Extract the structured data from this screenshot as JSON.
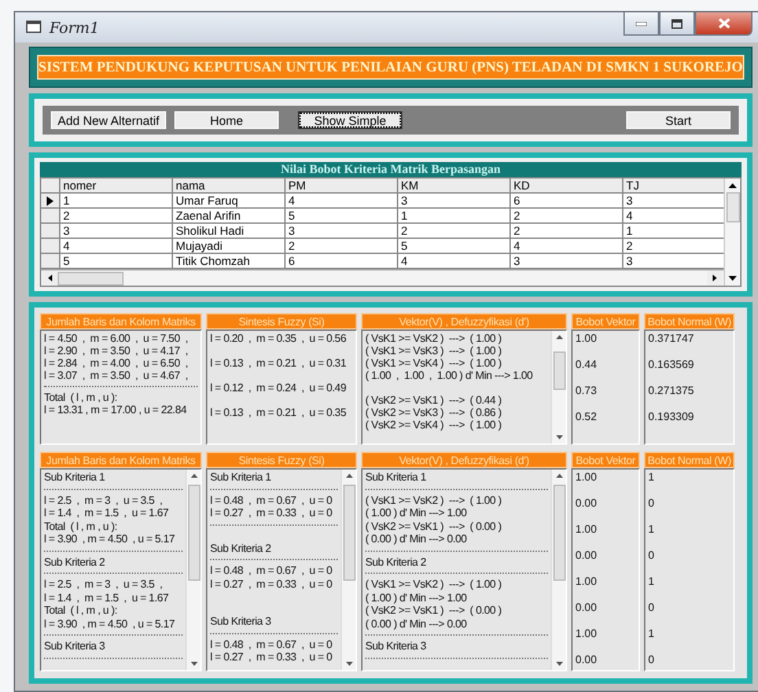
{
  "window": {
    "title": "Form1"
  },
  "banner": {
    "title": "SISTEM PENDUKUNG KEPUTUSAN UNTUK PENILAIAN GURU (PNS) TELADAN DI SMKN 1 SUKOREJO"
  },
  "toolbar": {
    "buttons": [
      {
        "label": "Add New Alternatif",
        "focused": false
      },
      {
        "label": "Home",
        "focused": false
      },
      {
        "label": "Show Simple",
        "focused": true
      },
      {
        "label": "Start",
        "focused": false
      }
    ]
  },
  "grid": {
    "title": "Nilai Bobot Kriteria Matrik Berpasangan",
    "columns": [
      "nomer",
      "nama",
      "PM",
      "KM",
      "KD",
      "TJ"
    ],
    "rows": [
      {
        "selected": true,
        "cells": [
          "1",
          "Umar Faruq",
          "4",
          "3",
          "6",
          "3"
        ]
      },
      {
        "selected": false,
        "cells": [
          "2",
          "Zaenal Arifin",
          "5",
          "1",
          "2",
          "4"
        ]
      },
      {
        "selected": false,
        "cells": [
          "3",
          "Sholikul Hadi",
          "3",
          "2",
          "2",
          "1"
        ]
      },
      {
        "selected": false,
        "cells": [
          "4",
          "Mujayadi",
          "2",
          "5",
          "4",
          "2"
        ]
      },
      {
        "selected": false,
        "cells": [
          "5",
          "Titik Chomzah",
          "6",
          "4",
          "3",
          "3"
        ]
      }
    ]
  },
  "tables": [
    {
      "columns": [
        {
          "header": "Jumlah Baris dan Kolom Matriks",
          "kind": "lines",
          "scrollbar": false,
          "lines": [
            {
              "kind": "text",
              "text": "l = 4.50  ,  m = 6.00  ,  u = 7.50  ,"
            },
            {
              "kind": "text",
              "text": "l = 2.90  ,  m = 3.50  ,  u = 4.17  ,"
            },
            {
              "kind": "text",
              "text": "l = 2.84  ,  m = 4.00  ,  u = 6.50  ,"
            },
            {
              "kind": "text",
              "text": "l = 3.07  ,  m = 3.50  ,  u = 4.67  ,"
            },
            {
              "kind": "rule"
            },
            {
              "kind": "text",
              "text": "Total  ( l , m , u ):"
            },
            {
              "kind": "text",
              "text": "l = 13.31 , m = 17.00 , u = 22.84"
            }
          ]
        },
        {
          "header": "Sintesis Fuzzy (Si)",
          "kind": "lines",
          "scrollbar": false,
          "lines": [
            {
              "kind": "text",
              "text": "l = 0.20  ,  m = 0.35  ,  u = 0.56"
            },
            {
              "kind": "gap"
            },
            {
              "kind": "text",
              "text": "l = 0.13  ,  m = 0.21  ,  u = 0.31"
            },
            {
              "kind": "gap"
            },
            {
              "kind": "text",
              "text": "l = 0.12  ,  m = 0.24  ,  u = 0.49"
            },
            {
              "kind": "gap"
            },
            {
              "kind": "text",
              "text": "l = 0.13  ,  m = 0.21  ,  u = 0.35"
            }
          ]
        },
        {
          "header": "Vektor(V) , Defuzzyfikasi (d')",
          "kind": "lines",
          "scrollbar": true,
          "lines": [
            {
              "kind": "text",
              "text": "( VsK1 >= VsK2 )  --->  ( 1.00 )"
            },
            {
              "kind": "text",
              "text": "( VsK1 >= VsK3 )  --->  ( 1.00 )"
            },
            {
              "kind": "text",
              "text": "( VsK1 >= VsK4 )  --->  ( 1.00 )"
            },
            {
              "kind": "text",
              "text": "( 1.00  ,  1.00  ,  1.00 ) d' Min ---> 1.00"
            },
            {
              "kind": "gap"
            },
            {
              "kind": "text",
              "text": "( VsK2 >= VsK1 )  --->  ( 0.44 )"
            },
            {
              "kind": "text",
              "text": "( VsK2 >= VsK3 )  --->  ( 0.86 )"
            },
            {
              "kind": "text",
              "text": "( VsK2 >= VsK4 )  --->  ( 1.00 )"
            }
          ]
        },
        {
          "header": "Bobot Vektor",
          "kind": "values",
          "scrollbar": false,
          "values": [
            "1.00",
            "0.44",
            "0.73",
            "0.52"
          ]
        },
        {
          "header": "Bobot Normal (W)",
          "kind": "values",
          "scrollbar": false,
          "values": [
            "0.371747",
            "0.163569",
            "0.271375",
            "0.193309"
          ]
        }
      ]
    },
    {
      "columns": [
        {
          "header": "Jumlah Baris dan Kolom Matriks",
          "kind": "lines",
          "scrollbar": true,
          "lines": [
            {
              "kind": "text",
              "text": "Sub Kriteria 1"
            },
            {
              "kind": "rule"
            },
            {
              "kind": "text",
              "text": "l = 2.5  ,  m = 3  ,  u = 3.5  ,"
            },
            {
              "kind": "text",
              "text": "l = 1.4  ,  m = 1.5  ,  u = 1.67"
            },
            {
              "kind": "text",
              "text": "Total  ( l , m , u ):"
            },
            {
              "kind": "text",
              "text": "l = 3.90  , m = 4.50  , u = 5.17"
            },
            {
              "kind": "rule"
            },
            {
              "kind": "text",
              "text": "Sub Kriteria 2"
            },
            {
              "kind": "rule"
            },
            {
              "kind": "text",
              "text": "l = 2.5  ,  m = 3  ,  u = 3.5  ,"
            },
            {
              "kind": "text",
              "text": "l = 1.4  ,  m = 1.5  ,  u = 1.67"
            },
            {
              "kind": "text",
              "text": "Total  ( l , m , u ):"
            },
            {
              "kind": "text",
              "text": "l = 3.90  , m = 4.50  , u = 5.17"
            },
            {
              "kind": "rule"
            },
            {
              "kind": "text",
              "text": "Sub Kriteria 3"
            },
            {
              "kind": "rule"
            }
          ]
        },
        {
          "header": "Sintesis Fuzzy (Si)",
          "kind": "lines",
          "scrollbar": true,
          "lines": [
            {
              "kind": "text",
              "text": "Sub Kriteria 1"
            },
            {
              "kind": "rule"
            },
            {
              "kind": "text",
              "text": "l = 0.48  ,  m = 0.67  ,  u = 0"
            },
            {
              "kind": "text",
              "text": "l = 0.27  ,  m = 0.33  ,  u = 0"
            },
            {
              "kind": "rule"
            },
            {
              "kind": "gap"
            },
            {
              "kind": "text",
              "text": "Sub Kriteria 2"
            },
            {
              "kind": "rule"
            },
            {
              "kind": "text",
              "text": "l = 0.48  ,  m = 0.67  ,  u = 0"
            },
            {
              "kind": "text",
              "text": "l = 0.27  ,  m = 0.33  ,  u = 0"
            },
            {
              "kind": "gap"
            },
            {
              "kind": "gap"
            },
            {
              "kind": "text",
              "text": "Sub Kriteria 3"
            },
            {
              "kind": "rule"
            },
            {
              "kind": "text",
              "text": "l = 0.48  ,  m = 0.67  ,  u = 0"
            },
            {
              "kind": "text",
              "text": "l = 0.27  ,  m = 0.33  ,  u = 0"
            }
          ]
        },
        {
          "header": "Vektor(V) , Defuzzyfikasi (d')",
          "kind": "lines",
          "scrollbar": true,
          "lines": [
            {
              "kind": "text",
              "text": "Sub Kriteria 1"
            },
            {
              "kind": "rule"
            },
            {
              "kind": "text",
              "text": "( VsK1 >= VsK2 )  --->  ( 1.00 )"
            },
            {
              "kind": "text",
              "text": "( 1.00 ) d' Min ---> 1.00"
            },
            {
              "kind": "text",
              "text": "( VsK2 >= VsK1 )  --->  ( 0.00 )"
            },
            {
              "kind": "text",
              "text": "( 0.00 ) d' Min ---> 0.00"
            },
            {
              "kind": "rule"
            },
            {
              "kind": "text",
              "text": "Sub Kriteria 2"
            },
            {
              "kind": "rule"
            },
            {
              "kind": "text",
              "text": "( VsK1 >= VsK2 )  --->  ( 1.00 )"
            },
            {
              "kind": "text",
              "text": "( 1.00 ) d' Min ---> 1.00"
            },
            {
              "kind": "text",
              "text": "( VsK2 >= VsK1 )  --->  ( 0.00 )"
            },
            {
              "kind": "text",
              "text": "( 0.00 ) d' Min ---> 0.00"
            },
            {
              "kind": "rule"
            },
            {
              "kind": "text",
              "text": "Sub Kriteria 3"
            },
            {
              "kind": "rule"
            }
          ]
        },
        {
          "header": "Bobot Vektor",
          "kind": "values",
          "scrollbar": false,
          "values": [
            "1.00",
            "0.00",
            "1.00",
            "0.00",
            "1.00",
            "0.00",
            "1.00",
            "0.00"
          ]
        },
        {
          "header": "Bobot Normal (W)",
          "kind": "values",
          "scrollbar": false,
          "values": [
            "1",
            "0",
            "1",
            "0",
            "1",
            "0",
            "1",
            "0"
          ]
        }
      ]
    }
  ]
}
